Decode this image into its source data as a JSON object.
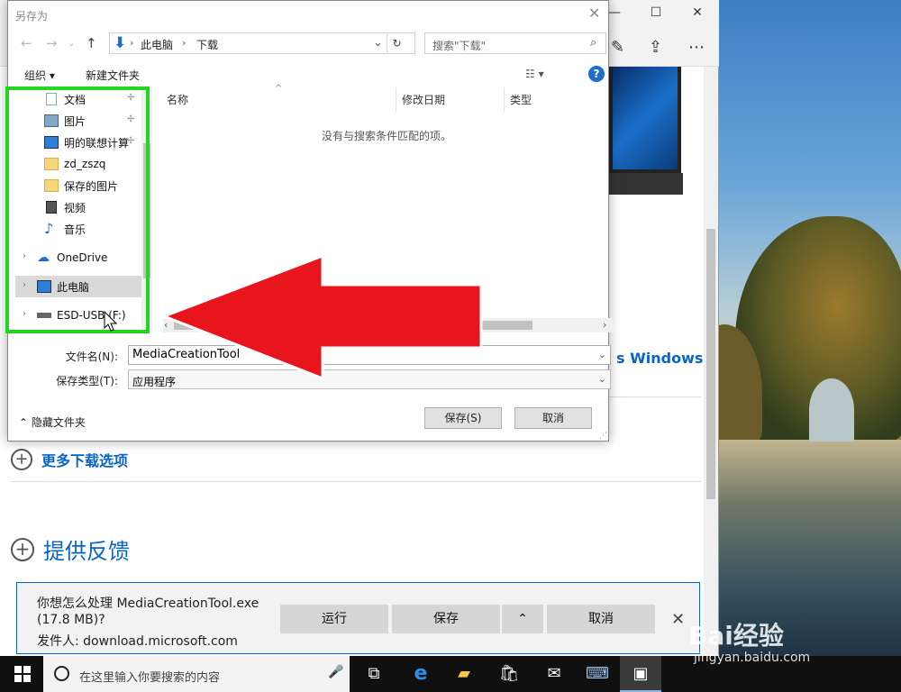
{
  "dialog": {
    "title": "另存为",
    "breadcrumb": [
      "此电脑",
      "下载"
    ],
    "search_placeholder": "搜索\"下载\"",
    "organize": "组织 ▾",
    "new_folder": "新建文件夹",
    "nav_items": [
      {
        "label": "文档",
        "pinned": true
      },
      {
        "label": "图片",
        "pinned": true
      },
      {
        "label": "明的联想计算",
        "pinned": true
      },
      {
        "label": "zd_zszq",
        "pinned": false
      },
      {
        "label": "保存的图片",
        "pinned": false
      },
      {
        "label": "视频",
        "pinned": false
      },
      {
        "label": "音乐",
        "pinned": false
      },
      {
        "label": "OneDrive",
        "expandable": true
      },
      {
        "label": "此电脑",
        "expandable": true,
        "selected": true
      },
      {
        "label": "ESD-USB (F:)",
        "expandable": true
      }
    ],
    "columns": [
      "名称",
      "修改日期",
      "类型"
    ],
    "empty_message": "没有与搜索条件匹配的项。",
    "filename_label": "文件名(N):",
    "filename_value": "MediaCreationTool",
    "filetype_label": "保存类型(T):",
    "filetype_value": "应用程序",
    "hide_folders": "隐藏文件夹",
    "save_button": "保存(S)",
    "cancel_button": "取消"
  },
  "browser": {
    "windows_link": "s Windows",
    "more_downloads": "更多下载选项",
    "feedback": "提供反馈"
  },
  "download_bar": {
    "line1": "你想怎么处理 MediaCreationTool.exe",
    "line2": "(17.8 MB)?",
    "line3": "发件人: download.microsoft.com",
    "run": "运行",
    "save": "保存",
    "cancel": "取消"
  },
  "taskbar": {
    "search_text": "在这里输入你要搜索的内容"
  },
  "watermark": {
    "brand": "Bai经验",
    "url": "jingyan.baidu.com"
  },
  "colors": {
    "highlight_box": "#22d622",
    "arrow": "#e8161c",
    "accent": "#0a64c8"
  }
}
